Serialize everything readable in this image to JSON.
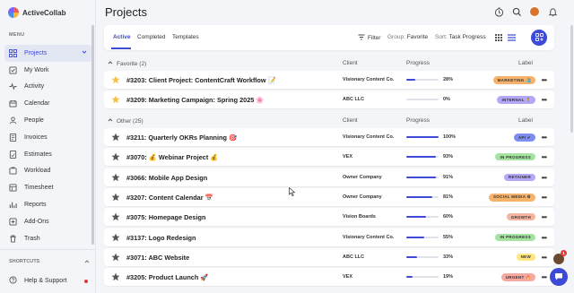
{
  "app": {
    "name": "ActiveCollab"
  },
  "sidebar": {
    "menu_heading": "MENU",
    "items": [
      {
        "label": "Projects",
        "icon": "projects-icon",
        "active": true
      },
      {
        "label": "My Work",
        "icon": "my-work-icon"
      },
      {
        "label": "Activity",
        "icon": "activity-icon"
      },
      {
        "label": "Calendar",
        "icon": "calendar-icon"
      },
      {
        "label": "People",
        "icon": "people-icon"
      },
      {
        "label": "Invoices",
        "icon": "invoices-icon"
      },
      {
        "label": "Estimates",
        "icon": "estimates-icon"
      },
      {
        "label": "Workload",
        "icon": "workload-icon"
      },
      {
        "label": "Timesheet",
        "icon": "timesheet-icon"
      },
      {
        "label": "Reports",
        "icon": "reports-icon"
      },
      {
        "label": "Add-Ons",
        "icon": "add-ons-icon"
      },
      {
        "label": "Trash",
        "icon": "trash-icon"
      }
    ],
    "shortcuts_heading": "SHORTCUTS",
    "help_label": "Help & Support"
  },
  "page": {
    "title": "Projects"
  },
  "toolbar": {
    "tabs": [
      "Active",
      "Completed",
      "Templates"
    ],
    "filter_label": "Filter",
    "group_label": "Group:",
    "group_value": "Favorite",
    "sort_label": "Sort:",
    "sort_value": "Task Progress"
  },
  "columns": {
    "client": "Client",
    "progress": "Progress",
    "label": "Label"
  },
  "sections": [
    {
      "title": "Favorite (2)",
      "rows": [
        {
          "name": "#3203: Client Project: ContentCraft Workflow 📝",
          "client": "Visionary Content Co.",
          "progress": 28,
          "progress_text": "28%",
          "label": "MARKETING 🏄",
          "label_color": "#f6b26b",
          "favorite": true
        },
        {
          "name": "#3209: Marketing Campaign: Spring 2025 🌸",
          "client": "ABC LLC",
          "progress": 0,
          "progress_text": "0%",
          "label": "INTERNAL 🧍",
          "label_color": "#b4a7f5",
          "favorite": true
        }
      ]
    },
    {
      "title": "Other (25)",
      "rows": [
        {
          "name": "#3211: Quarterly OKRs Planning 🎯",
          "client": "Visionary Content Co.",
          "progress": 100,
          "progress_text": "100%",
          "label": "API ✔",
          "label_color": "#7e8ef0",
          "favorite": false
        },
        {
          "name": "#3070: 💰 Webinar Project 💰",
          "client": "VEX",
          "progress": 93,
          "progress_text": "93%",
          "label": "IN PROGRESS",
          "label_color": "#a6e3a1",
          "favorite": false
        },
        {
          "name": "#3066: Mobile App Design",
          "client": "Owner Company",
          "progress": 91,
          "progress_text": "91%",
          "label": "RETAINER",
          "label_color": "#b4a7f5",
          "favorite": false
        },
        {
          "name": "#3207: Content Calendar 📅",
          "client": "Owner Company",
          "progress": 81,
          "progress_text": "81%",
          "label": "SOCIAL MEDIA ⚙",
          "label_color": "#f6b26b",
          "favorite": false
        },
        {
          "name": "#3075: Homepage Design",
          "client": "Vision Boards",
          "progress": 60,
          "progress_text": "60%",
          "label": "GROWTH",
          "label_color": "#f4b6a0",
          "favorite": false
        },
        {
          "name": "#3137: Logo Redesign",
          "client": "Visionary Content Co.",
          "progress": 55,
          "progress_text": "55%",
          "label": "IN PROGRESS",
          "label_color": "#a6e3a1",
          "favorite": false
        },
        {
          "name": "#3071: ABC Website",
          "client": "ABC LLC",
          "progress": 33,
          "progress_text": "33%",
          "label": "NEW",
          "label_color": "#ffe680",
          "favorite": false
        },
        {
          "name": "#3205: Product Launch 🚀",
          "client": "VEX",
          "progress": 19,
          "progress_text": "19%",
          "label": "URGENT 🔥",
          "label_color": "#f7a8a0",
          "favorite": false
        }
      ]
    }
  ],
  "chat": {
    "badge": "1"
  },
  "colors": {
    "accent": "#3d4ad7",
    "star_favorite": "#f5c242",
    "star_other": "#555555"
  }
}
